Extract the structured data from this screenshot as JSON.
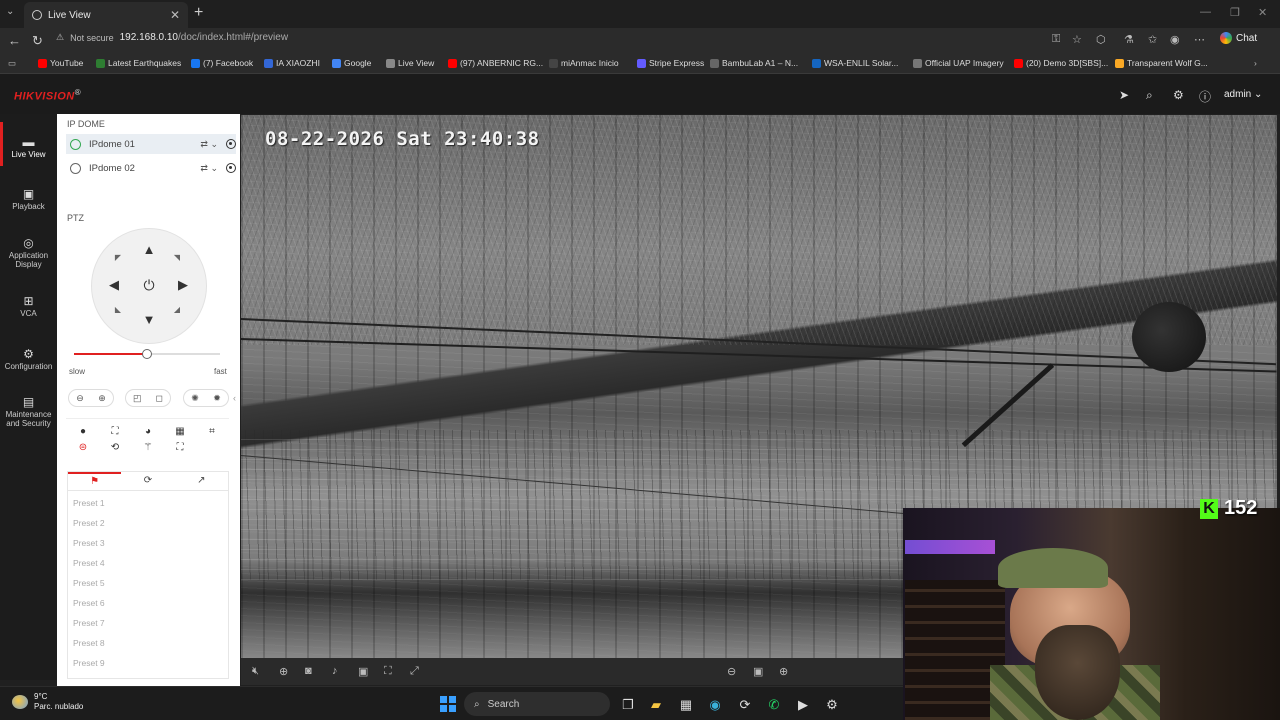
{
  "browser": {
    "tab_title": "Live View",
    "not_secure": "Not secure",
    "url_host": "192.168.0.10",
    "url_path": "/doc/index.html#/preview",
    "chat_label": "Chat",
    "bookmarks": [
      {
        "label": "YouTube",
        "color": "#ff0000"
      },
      {
        "label": "Latest Earthquakes",
        "color": "#2e7d32"
      },
      {
        "label": "(7) Facebook",
        "color": "#1877f2"
      },
      {
        "label": "IA XIAOZHI",
        "color": "#3367d6"
      },
      {
        "label": "Google",
        "color": "#4285f4"
      },
      {
        "label": "Live View",
        "color": "#888888"
      },
      {
        "label": "(97) ANBERNIC RG...",
        "color": "#ff0000"
      },
      {
        "label": "miAnmac Inicio",
        "color": "#444444"
      },
      {
        "label": "Stripe Express",
        "color": "#635bff"
      },
      {
        "label": "BambuLab A1 – N...",
        "color": "#666666"
      },
      {
        "label": "WSA-ENLIL Solar...",
        "color": "#1565c0"
      },
      {
        "label": "Official UAP Imagery",
        "color": "#777777"
      },
      {
        "label": "(20) Demo 3D[SBS]...",
        "color": "#ff0000"
      },
      {
        "label": "Transparent Wolf G...",
        "color": "#f9a825"
      }
    ]
  },
  "header": {
    "brand": "HIKVISION",
    "brand_mark": "®",
    "user": "admin"
  },
  "nav": [
    {
      "label": "Live View",
      "icon": "monitor-icon"
    },
    {
      "label": "Playback",
      "icon": "playback-icon"
    },
    {
      "label": "Application Display",
      "icon": "app-display-icon"
    },
    {
      "label": "VCA",
      "icon": "vca-icon"
    },
    {
      "label": "Configuration",
      "icon": "gear-icon"
    },
    {
      "label": "Maintenance and Security",
      "icon": "maintenance-icon"
    }
  ],
  "panel": {
    "group_title": "IP DOME",
    "cameras": [
      "IPdome 01",
      "IPdome 02"
    ],
    "ptz_title": "PTZ",
    "speed_slow": "slow",
    "speed_fast": "fast",
    "speed_level": 0.5,
    "presets": [
      "Preset 1",
      "Preset 2",
      "Preset 3",
      "Preset 4",
      "Preset 5",
      "Preset 6",
      "Preset 7",
      "Preset 8",
      "Preset 9"
    ]
  },
  "video": {
    "osd_timestamp": "08-22-2026 Sat 23:40:38"
  },
  "overlay": {
    "kick_count": "152"
  },
  "taskbar": {
    "temperature": "9°C",
    "weather": "Parc. nublado",
    "search": "Search"
  },
  "colors": {
    "accent": "#e02020",
    "kick_green": "#53fc18"
  }
}
